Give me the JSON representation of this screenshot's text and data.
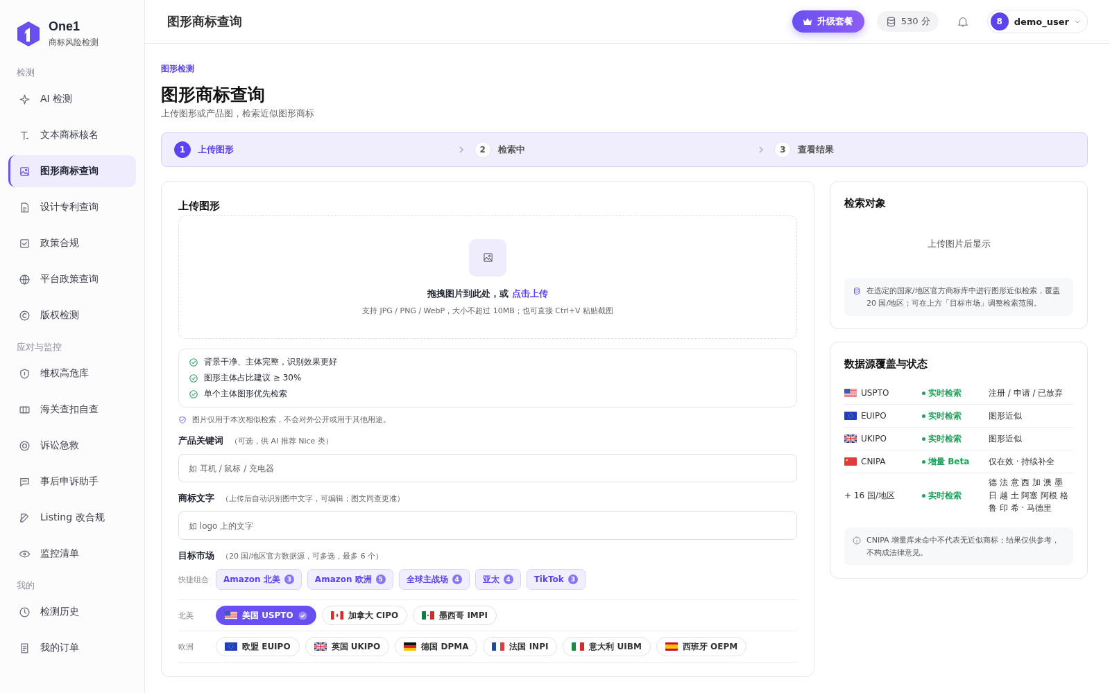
{
  "brand": {
    "name": "One1",
    "subtitle": "商标风险检测"
  },
  "sidebar": {
    "sections": [
      {
        "title": "检测",
        "items": [
          {
            "label": "AI 检测",
            "selected": false
          },
          {
            "label": "文本商标核名",
            "selected": false
          },
          {
            "label": "图形商标查询",
            "selected": true
          },
          {
            "label": "设计专利查询",
            "selected": false
          },
          {
            "label": "政策合规",
            "selected": false
          },
          {
            "label": "平台政策查询",
            "selected": false
          },
          {
            "label": "版权检测",
            "selected": false
          }
        ]
      },
      {
        "title": "应对与监控",
        "items": [
          {
            "label": "维权高危库",
            "selected": false
          },
          {
            "label": "海关查扣自查",
            "selected": false
          },
          {
            "label": "诉讼急救",
            "selected": false
          },
          {
            "label": "事后申诉助手",
            "selected": false
          },
          {
            "label": "Listing 改合规",
            "selected": false
          },
          {
            "label": "监控清单",
            "selected": false
          }
        ]
      },
      {
        "title": "我的",
        "items": [
          {
            "label": "检测历史",
            "selected": false
          },
          {
            "label": "我的订单",
            "selected": false
          }
        ]
      }
    ]
  },
  "header": {
    "title": "图形商标查询",
    "upgrade": "升级套餐",
    "points": "530 分",
    "avatar": "8",
    "user": "demo_user"
  },
  "page": {
    "breadcrumb": "图形检测",
    "title": "图形商标查询",
    "subtitle": "上传图形或产品图，检索近似图形商标"
  },
  "steps": [
    {
      "number": "1",
      "label": "上传图形",
      "selected": true
    },
    {
      "number": "2",
      "label": "检索中",
      "selected": false
    },
    {
      "number": "3",
      "label": "查看结果",
      "selected": false
    }
  ],
  "upload": {
    "title": "上传图形",
    "drop_text": "拖拽图片到此处，或 ",
    "drop_link": "点击上传",
    "hint": "支持 JPG / PNG / WebP，大小不超过 10MB；也可直接 Ctrl+V 粘贴截图",
    "tips": [
      "背景干净、主体完整，识别效果更好",
      "图形主体占比建议 ≥ 30%",
      "单个主体图形优先检索"
    ],
    "privacy": "图片仅用于本次相似检索，不会对外公开或用于其他用途。",
    "keyword": {
      "label": "产品关键词",
      "note": "（可选，供 AI 推荐 Nice 类）",
      "placeholder": "如 耳机 / 鼠标 / 充电器"
    },
    "mark_text": {
      "label": "商标文字",
      "note": "（上传后自动识别图中文字，可编辑；图文同查更准）",
      "placeholder": "如 logo 上的文字"
    },
    "markets": {
      "label": "目标市场",
      "note": "（20 国/地区官方数据源，可多选，最多 6 个）",
      "quick_label": "快捷组合",
      "quick": [
        {
          "label": "Amazon 北美",
          "count": "3"
        },
        {
          "label": "Amazon 欧洲",
          "count": "5"
        },
        {
          "label": "全球主战场",
          "count": "4"
        },
        {
          "label": "亚太",
          "count": "4"
        },
        {
          "label": "TikTok",
          "count": "3"
        }
      ],
      "regions": [
        {
          "name": "北美",
          "chips": [
            {
              "kind": "us",
              "label": "美国 USPTO",
              "selected": true
            },
            {
              "kind": "ca",
              "label": "加拿大 CIPO",
              "selected": false
            },
            {
              "kind": "mx",
              "label": "墨西哥 IMPI",
              "selected": false
            }
          ]
        },
        {
          "name": "欧洲",
          "chips": [
            {
              "kind": "eu",
              "label": "欧盟 EUIPO",
              "selected": false
            },
            {
              "kind": "gb",
              "label": "英国 UKIPO",
              "selected": false
            },
            {
              "kind": "de",
              "label": "德国 DPMA",
              "selected": false
            },
            {
              "kind": "fr",
              "label": "法国 INPI",
              "selected": false
            },
            {
              "kind": "it",
              "label": "意大利 UIBM",
              "selected": false
            },
            {
              "kind": "es",
              "label": "西班牙 OEPM",
              "selected": false
            }
          ]
        }
      ]
    }
  },
  "target": {
    "title": "检索对象",
    "empty": "上传图片后显示",
    "note": "在选定的国家/地区官方商标库中进行图形近似检索，覆盖 20 国/地区；可在上方「目标市场」调整检索范围。"
  },
  "sources": {
    "title": "数据源覆盖与状态",
    "rows": [
      {
        "kind": "us",
        "name": "USPTO",
        "status": "实时检索",
        "scope": [
          "注册 / 申请 / 已放弃"
        ]
      },
      {
        "kind": "eu",
        "name": "EUIPO",
        "status": "实时检索",
        "scope": [
          "图形近似"
        ]
      },
      {
        "kind": "gb",
        "name": "UKIPO",
        "status": "实时检索",
        "scope": [
          "图形近似"
        ]
      },
      {
        "kind": "cn",
        "name": "CNIPA",
        "status": "增量 Beta",
        "scope": [
          "仅在效 · 持续补全"
        ]
      },
      {
        "kind": "none",
        "name": "+ 16 国/地区",
        "status": "实时检索",
        "scope": [
          "德 法 意 西 加 澳 墨",
          "日 越 土 阿塞 阿根 格",
          "鲁 印 希 · 马德里"
        ]
      }
    ],
    "note": "CNIPA 增量库未命中不代表无近似商标；结果仅供参考，不构成法律意见。"
  }
}
